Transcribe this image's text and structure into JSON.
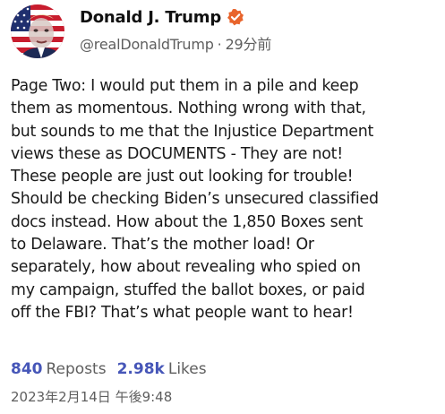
{
  "post": {
    "author": {
      "display_name": "Donald J. Trump",
      "handle": "@realDonaldTrump",
      "separator": "·",
      "relative_time": "29分前",
      "verified_icon": "verified-badge-icon",
      "avatar_icon": "profile-avatar"
    },
    "text": "Page Two: I would put them in a pile and keep\nthem as momentous. Nothing wrong with that,\nbut sounds to me that the Injustice Department\nviews these as DOCUMENTS - They are not!\nThese people are just out looking for trouble!\nShould be checking Biden’s unsecured classified\ndocs instead. How about the 1,850 Boxes sent\nto Delaware. That’s the mother load!  Or\nseparately, how about revealing who spied on\nmy campaign, stuffed the ballot boxes, or paid\noff the FBI? That’s what people want to hear!",
    "stats": {
      "reposts_count": "840",
      "reposts_label": "Reposts",
      "likes_count": "2.98k",
      "likes_label": "Likes"
    },
    "timestamp": "2023年2月14日 午後9:48"
  },
  "colors": {
    "accent": "#4656b8",
    "verified": "#e8642c",
    "muted_text": "#5e5e5e",
    "body_text": "#1a1a1a"
  }
}
